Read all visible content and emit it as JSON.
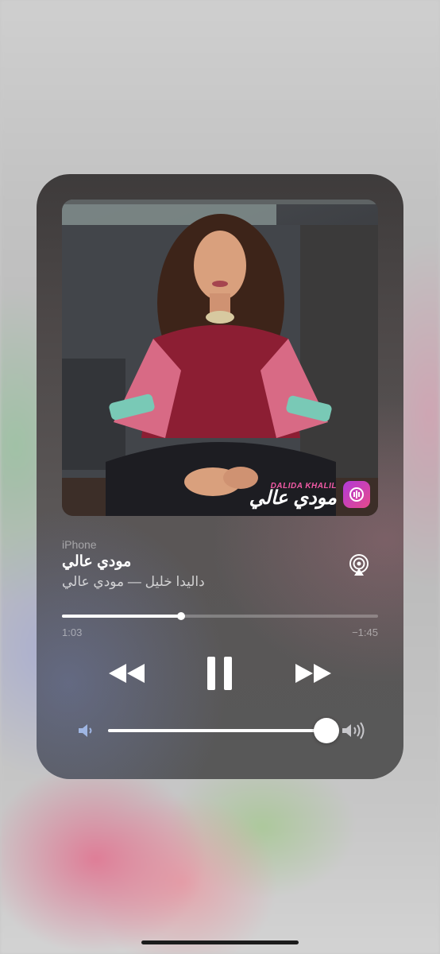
{
  "now_playing": {
    "device": "iPhone",
    "song_title": "مودي عالي",
    "subtitle": "داليدا خليل — مودي عالي",
    "progress_fraction": 0.376,
    "elapsed": "1:03",
    "remaining": "−1:45",
    "volume_fraction": 0.96
  },
  "album_art": {
    "brand": "DALIDA KHALIL",
    "title": "مودي عالي"
  },
  "icons": {
    "airplay": "airplay-audio-icon",
    "prev": "rewind-icon",
    "play_pause": "pause-icon",
    "next": "fast-forward-icon",
    "volume_low": "speaker-low-icon",
    "volume_high": "speaker-high-icon",
    "album_badge": "anghami-app-icon"
  },
  "colors": {
    "badge_start": "#b23ad8",
    "badge_end": "#e64a8c",
    "brand_pink": "#f25aa6"
  }
}
